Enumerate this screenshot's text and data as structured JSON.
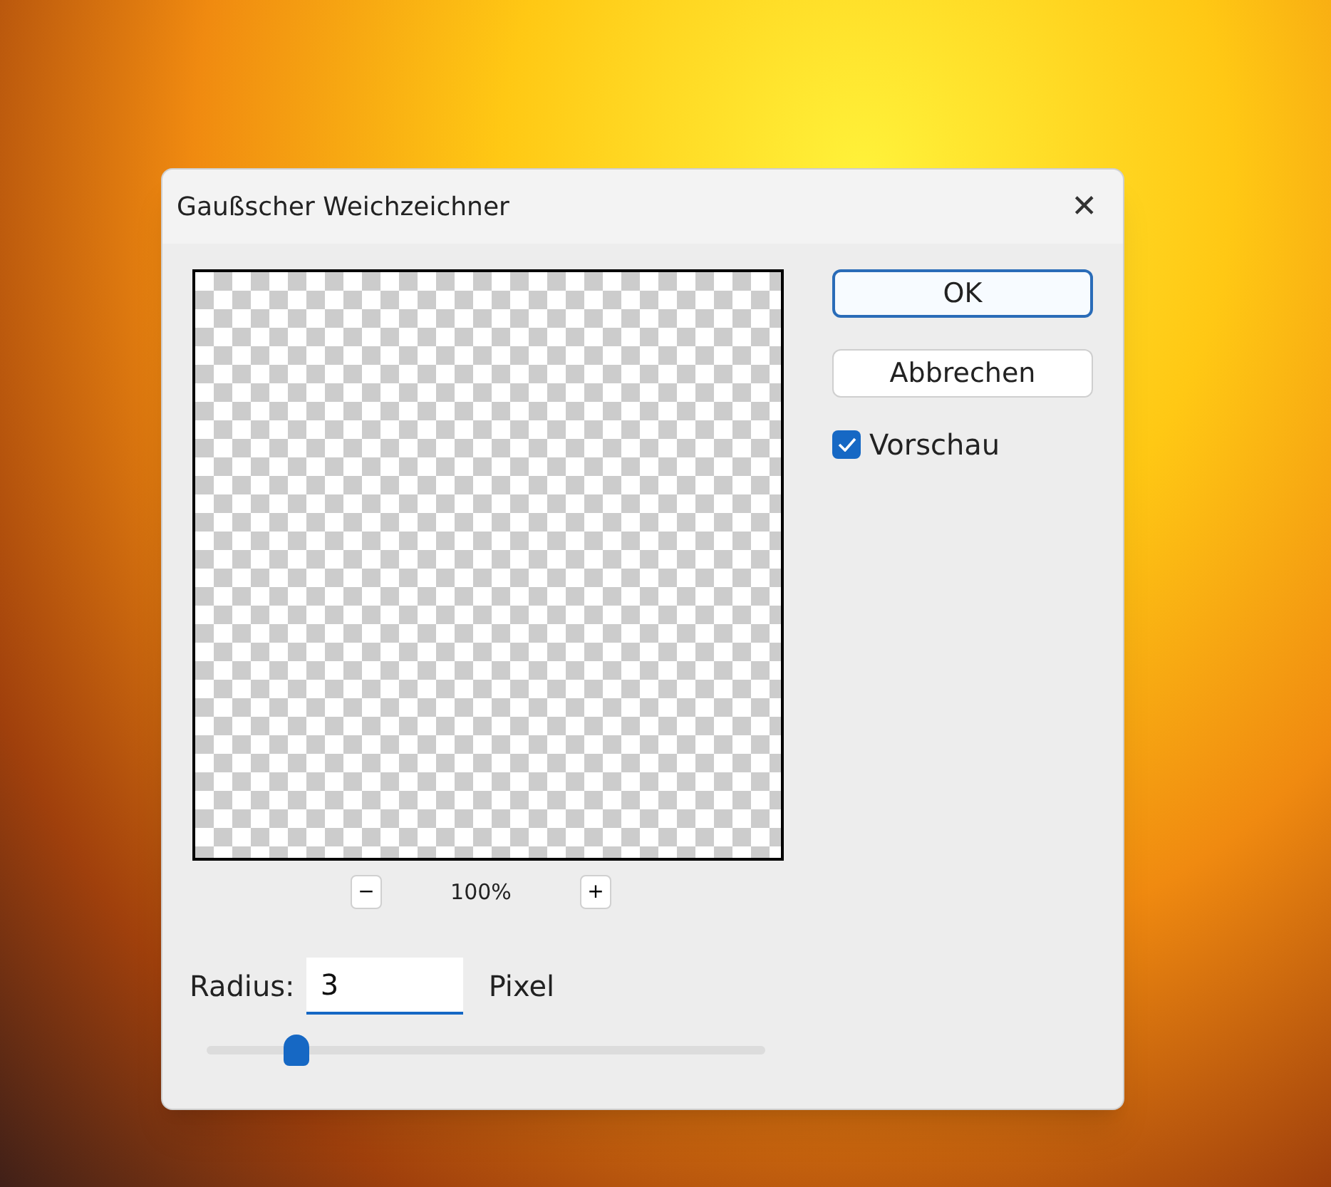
{
  "window": {
    "title": "Gaußscher Weichzeichner",
    "close": "✕"
  },
  "preview": {
    "zoom_out": "−",
    "zoom": "100%",
    "zoom_in": "+"
  },
  "buttons": [
    {
      "label": "OK",
      "default": true
    },
    {
      "label": "Abbrechen",
      "default": false
    }
  ],
  "preview_checkbox": {
    "label": "Vorschau",
    "checked": true
  },
  "radius": {
    "label": "Radius:",
    "value": "3",
    "unit": "Pixel",
    "level": 0.16
  }
}
